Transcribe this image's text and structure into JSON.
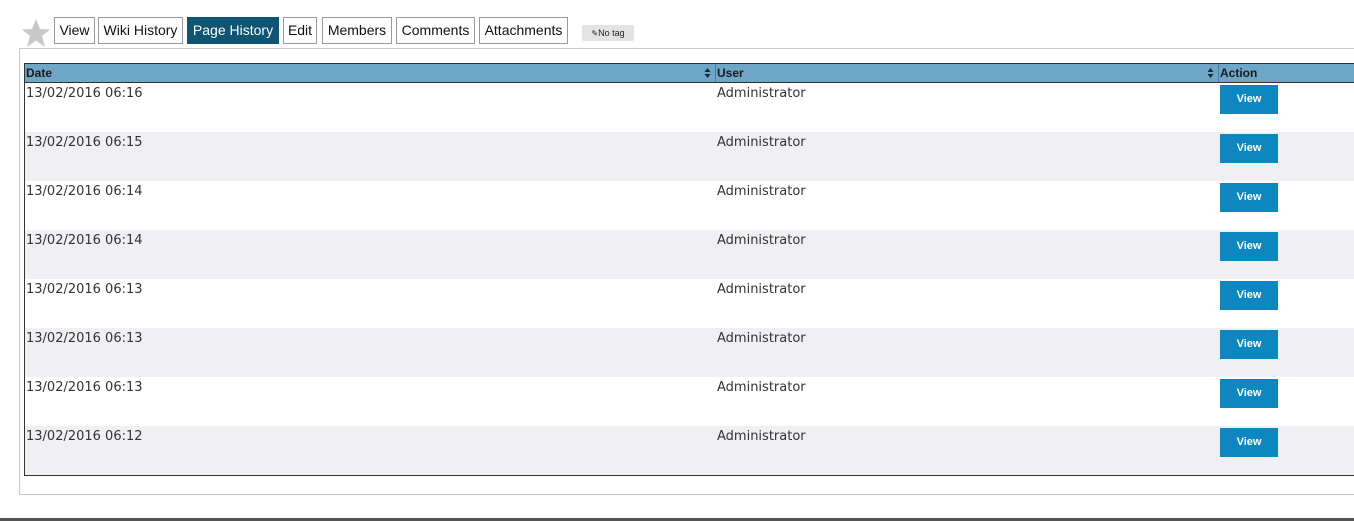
{
  "toolbar": {
    "tabs": [
      {
        "label": "View",
        "active": false
      },
      {
        "label": "Wiki History",
        "active": false
      },
      {
        "label": "Page History",
        "active": true
      },
      {
        "label": "Edit",
        "active": false
      },
      {
        "label": "Members",
        "active": false
      },
      {
        "label": "Comments",
        "active": false
      },
      {
        "label": "Attachments",
        "active": false
      }
    ],
    "tag_label": "No tag",
    "icons": {
      "favorite": "star-icon",
      "tag": "tag-icon"
    }
  },
  "table": {
    "columns": {
      "date": "Date",
      "user": "User",
      "action": "Action"
    },
    "rows": [
      {
        "date": "13/02/2016 06:16",
        "user": "Administrator",
        "action": "View"
      },
      {
        "date": "13/02/2016 06:15",
        "user": "Administrator",
        "action": "View"
      },
      {
        "date": "13/02/2016 06:14",
        "user": "Administrator",
        "action": "View"
      },
      {
        "date": "13/02/2016 06:14",
        "user": "Administrator",
        "action": "View"
      },
      {
        "date": "13/02/2016 06:13",
        "user": "Administrator",
        "action": "View"
      },
      {
        "date": "13/02/2016 06:13",
        "user": "Administrator",
        "action": "View"
      },
      {
        "date": "13/02/2016 06:13",
        "user": "Administrator",
        "action": "View"
      },
      {
        "date": "13/02/2016 06:12",
        "user": "Administrator",
        "action": "View"
      }
    ]
  },
  "colors": {
    "active_tab": "#0d5573",
    "header_bg": "#6ea6c8",
    "view_button": "#0c87bf",
    "alt_row": "#efeff4"
  }
}
